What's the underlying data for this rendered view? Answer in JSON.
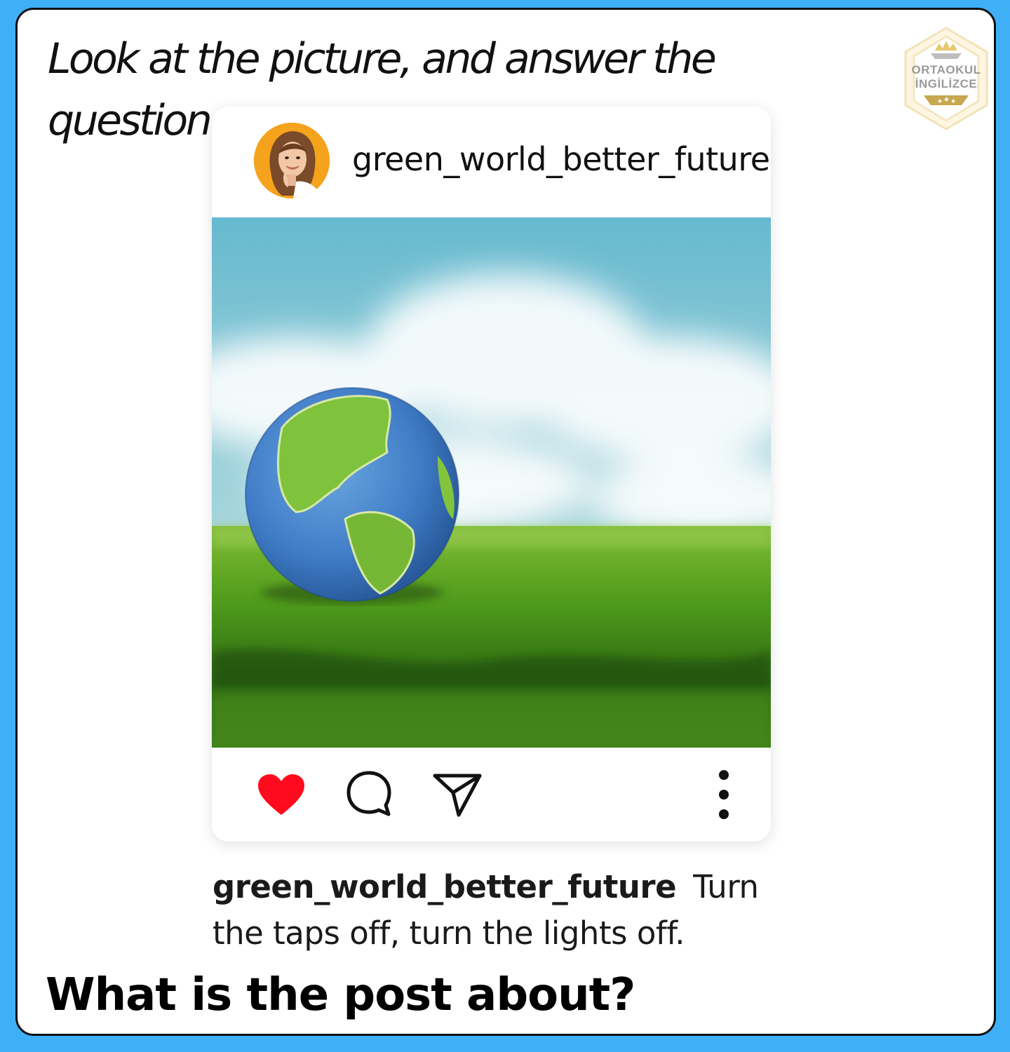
{
  "instruction": "Look at the picture, and answer the question.",
  "logo": {
    "line1": "ORTAOKUL",
    "line2": "İNGİLİZCE",
    "icon": "crown-hexagon-badge"
  },
  "post": {
    "username": "green_world_better_future",
    "avatar_icon": "profile-photo-woman",
    "image_description_icon": "earth-globe-on-moss",
    "actions": {
      "like_icon": "heart-icon",
      "like_color": "#ff0a1e",
      "comment_icon": "comment-bubble-icon",
      "share_icon": "paper-plane-icon",
      "more_icon": "more-vertical-icon"
    },
    "caption_user": "green_world_better_future",
    "caption_text": "Turn the taps off, turn the lights off."
  },
  "question": "What is the post about?",
  "colors": {
    "background": "#3fb0f7",
    "frame": "#ffffff",
    "border": "#111111"
  }
}
